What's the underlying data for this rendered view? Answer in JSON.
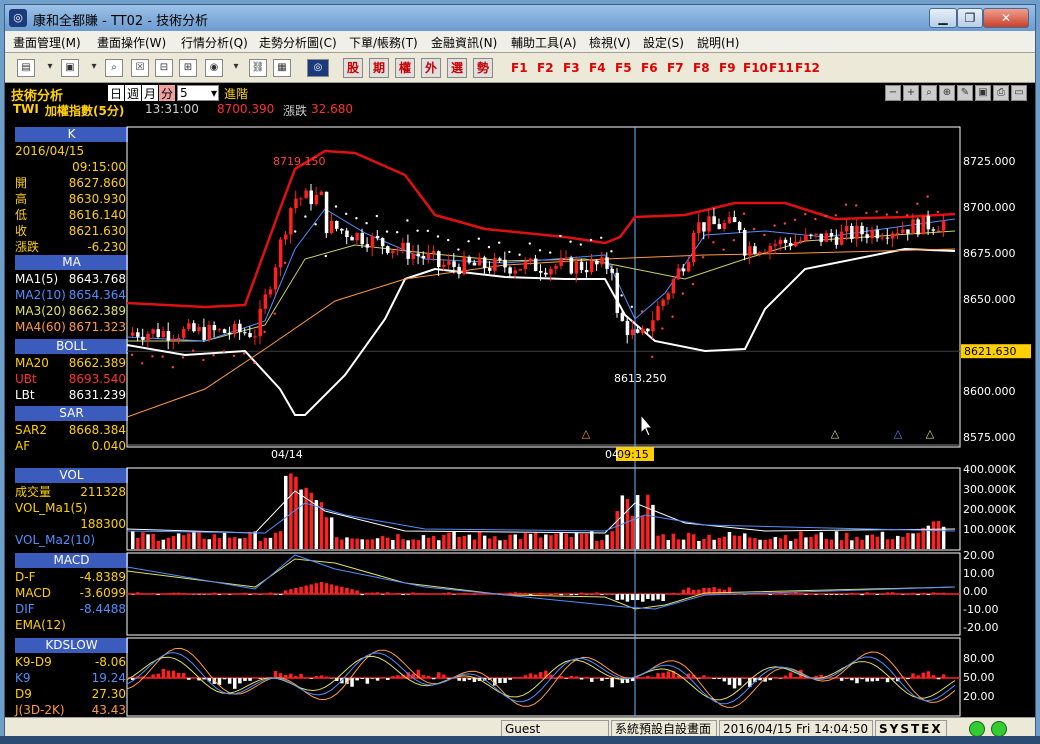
{
  "window": {
    "title": "康和全都賺 - TT02 - 技術分析",
    "app_icon": "app-logo-icon"
  },
  "menubar": {
    "items": [
      "畫面管理(M)",
      "畫面操作(W)",
      "行情分析(Q)",
      "走勢分析圖(C)",
      "下單/帳務(T)",
      "金融資訊(N)",
      "輔助工具(A)",
      "檢視(V)",
      "設定(S)",
      "說明(H)"
    ]
  },
  "toolbar": {
    "red_buttons": [
      "股",
      "期",
      "權",
      "外",
      "選",
      "勢"
    ],
    "fkeys": [
      "F1",
      "F2",
      "F3",
      "F4",
      "F5",
      "F6",
      "F7",
      "F8",
      "F9",
      "F10",
      "F11",
      "F12"
    ]
  },
  "info": {
    "title": "技術分析",
    "periods": [
      "日",
      "週",
      "月",
      "分"
    ],
    "active_period": "分",
    "interval": "5",
    "advanced": "進階",
    "symbol": "TWI",
    "name": "加權指數(5分)",
    "time": "13:31:00",
    "price": "8700.390",
    "change_label": "漲跌",
    "change": "32.680"
  },
  "legend": {
    "k": {
      "header": "K",
      "date": "2016/04/15",
      "time": "09:15:00",
      "rows": [
        [
          "開",
          "8627.860"
        ],
        [
          "高",
          "8630.930"
        ],
        [
          "低",
          "8616.140"
        ],
        [
          "收",
          "8621.630"
        ],
        [
          "漲跌",
          "-6.230"
        ]
      ]
    },
    "ma": {
      "header": "MA",
      "rows": [
        [
          "MA1(5)",
          "8643.768"
        ],
        [
          "MA2(10)",
          "8654.364"
        ],
        [
          "MA3(20)",
          "8662.389"
        ],
        [
          "MA4(60)",
          "8671.323"
        ]
      ]
    },
    "boll": {
      "header": "BOLL",
      "rows": [
        [
          "MA20",
          "8662.389"
        ],
        [
          "UBt",
          "8693.540"
        ],
        [
          "LBt",
          "8631.239"
        ]
      ]
    },
    "sar": {
      "header": "SAR",
      "rows": [
        [
          "SAR2",
          "8668.384"
        ],
        [
          "AF",
          "0.040"
        ]
      ]
    },
    "vol": {
      "header": "VOL",
      "rows": [
        [
          "成交量",
          "211328"
        ],
        [
          "VOL_Ma1(5)",
          ""
        ],
        [
          "",
          "188300"
        ],
        [
          "VOL_Ma2(10)",
          ""
        ]
      ]
    },
    "macd": {
      "header": "MACD",
      "rows": [
        [
          "D-F",
          "-4.8389"
        ],
        [
          "MACD",
          "-3.6099"
        ],
        [
          "DIF",
          "-8.4488"
        ],
        [
          "EMA(12)",
          ""
        ]
      ]
    },
    "kd": {
      "header": "KDSLOW",
      "rows": [
        [
          "K9-D9",
          "-8.06"
        ],
        [
          "K9",
          "19.24"
        ],
        [
          "D9",
          "27.30"
        ],
        [
          "J(3D-2K)",
          "43.43"
        ]
      ]
    }
  },
  "price_axis": [
    "8725.000",
    "8700.000",
    "8675.000",
    "8650.000",
    "8600.000",
    "8575.000"
  ],
  "current_price_tag": "8621.630",
  "annotations": {
    "high": "8719.150",
    "low": "8613.250"
  },
  "x_labels": [
    "04/14",
    "04"
  ],
  "cursor_time": "09:15",
  "vol_axis": [
    "400.000K",
    "300.000K",
    "200.000K",
    "100.000K"
  ],
  "macd_axis": [
    "20.00",
    "10.00",
    "0.00",
    "-10.00",
    "-20.00"
  ],
  "kd_axis": [
    "80.00",
    "50.00",
    "20.00"
  ],
  "status": {
    "user": "Guest",
    "layout": "系統預設自設畫面",
    "datetime": "2016/04/15 Fri 14:04:50",
    "brand": "SYSTEX"
  },
  "colors": {
    "up": "#ff2020",
    "down": "#ffffff",
    "header": "#3b5bbd",
    "boll_upper": "#e01010",
    "boll_lower": "#ffffff"
  }
}
